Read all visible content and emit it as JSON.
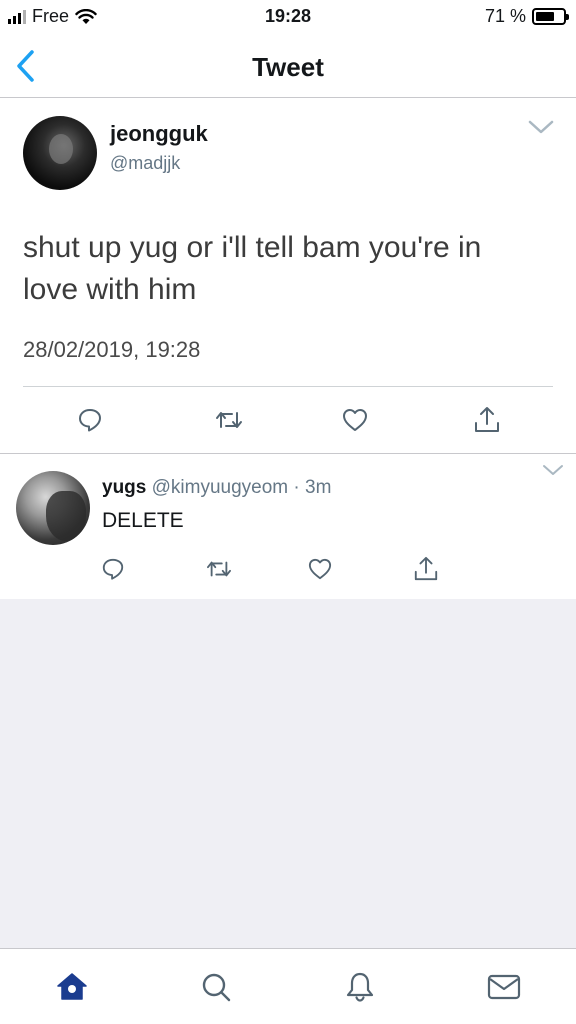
{
  "status_bar": {
    "carrier": "Free",
    "time": "19:28",
    "battery_text": "71 %",
    "battery_level": 0.71
  },
  "nav": {
    "title": "Tweet",
    "back_icon": "chevron-left-icon",
    "accent_color": "#1da1f2"
  },
  "main_tweet": {
    "name": "jeongguk",
    "handle": "@madjjk",
    "text": "shut up yug or i'll tell bam you're in love with him",
    "timestamp": "28/02/2019, 19:28",
    "actions": [
      "reply-icon",
      "retweet-icon",
      "like-icon",
      "share-icon"
    ]
  },
  "reply": {
    "name": "yugs",
    "handle": "@kimyuugyeom",
    "separator": "·",
    "age": "3m",
    "text": "DELETE",
    "actions": [
      "reply-icon",
      "retweet-icon",
      "like-icon",
      "share-icon"
    ]
  },
  "tab_bar": {
    "tabs": [
      "home-icon",
      "search-icon",
      "notifications-icon",
      "messages-icon"
    ],
    "active_tab": "home-icon",
    "active_color": "#1b3c8f",
    "inactive_color": "#536471"
  }
}
